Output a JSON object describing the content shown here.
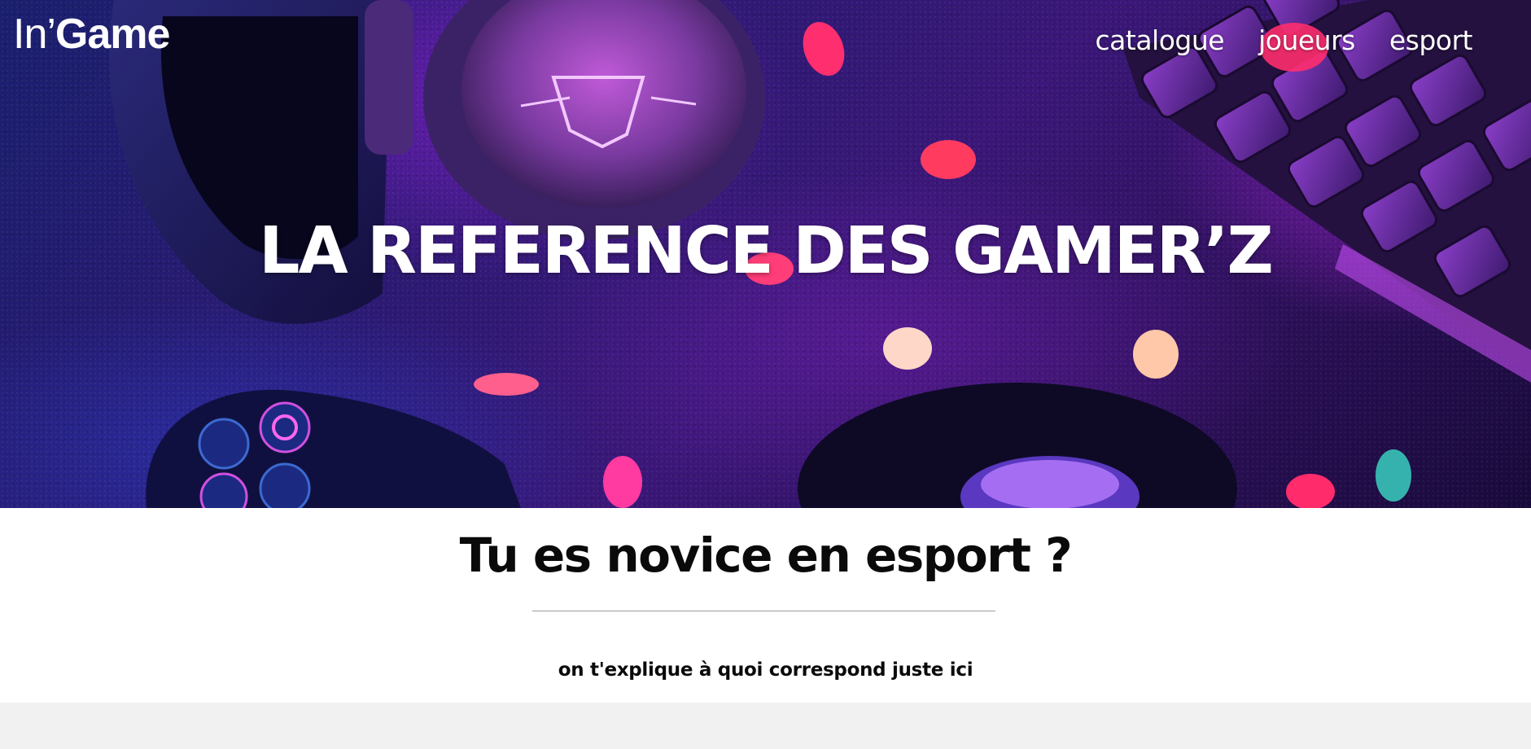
{
  "header": {
    "brand_prefix": "In’",
    "brand_main": "Game",
    "nav": [
      {
        "label": "catalogue"
      },
      {
        "label": "joueurs"
      },
      {
        "label": "esport"
      }
    ]
  },
  "hero": {
    "title": "LA REFERENCE DES GAMER’Z",
    "image_icon": "gaming-desk-photo"
  },
  "intro": {
    "title": "Tu es novice en esport ?",
    "text": "on t'explique à quoi correspond juste ici"
  },
  "colors": {
    "hero_purple": "#3a1778",
    "hero_blue": "#1a1f6e",
    "accent_pink": "#ff2e6e",
    "text_dark": "#0a0a0a",
    "footer_grey": "#f1f1f1"
  }
}
